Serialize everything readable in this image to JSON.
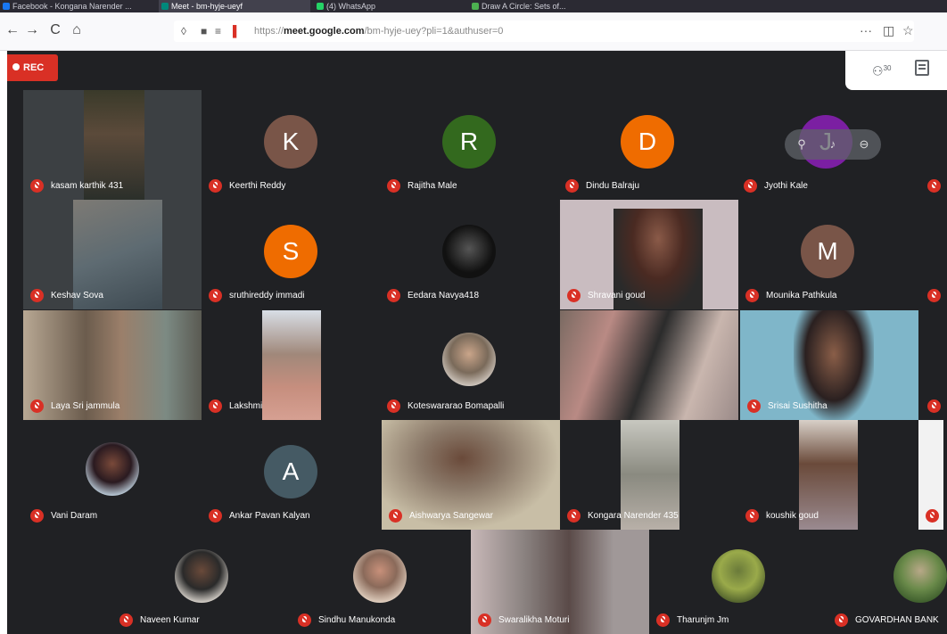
{
  "browser": {
    "tabs": [
      {
        "label": "Facebook - Kongana Narender ..."
      },
      {
        "label": "Meet - bm-hyje-ueyf"
      },
      {
        "label": "(4) WhatsApp"
      },
      {
        "label": "Draw A Circle: Sets of..."
      }
    ],
    "url_domain": "meet.google.com",
    "url_prefix": "https://",
    "url_path": "/bm-hyje-uey?pli=1&authuser=0",
    "more_label": "···",
    "nav": {
      "back": "←",
      "forward": "→",
      "reload": "C",
      "home": "⌂"
    }
  },
  "meet": {
    "rec_label": "REC",
    "people_count": "30",
    "participants": [
      {
        "name": "kasam karthik 431",
        "kind": "video"
      },
      {
        "name": "Keerthi Reddy",
        "kind": "letter",
        "letter": "K",
        "color": "#795548"
      },
      {
        "name": "Rajitha Male",
        "kind": "letter",
        "letter": "R",
        "color": "#33691e"
      },
      {
        "name": "Dindu Balraju",
        "kind": "letter",
        "letter": "D",
        "color": "#ef6c00"
      },
      {
        "name": "Jyothi Kale",
        "kind": "letter",
        "letter": "J",
        "color": "#7b1fa2"
      },
      {
        "name": "Keshav Sova",
        "kind": "video"
      },
      {
        "name": "sruthireddy immadi",
        "kind": "letter",
        "letter": "S",
        "color": "#ef6c00"
      },
      {
        "name": "Eedara Navya418",
        "kind": "photo"
      },
      {
        "name": "Shravani goud",
        "kind": "video"
      },
      {
        "name": "Mounika Pathkula",
        "kind": "letter",
        "letter": "M",
        "color": "#795548"
      },
      {
        "name": "Laya Sri jammula",
        "kind": "video"
      },
      {
        "name": "Lakshmi",
        "kind": "video"
      },
      {
        "name": "Koteswararao Bomapalli",
        "kind": "photo"
      },
      {
        "name": "",
        "kind": "video"
      },
      {
        "name": "Srisai Sushitha",
        "kind": "video"
      },
      {
        "name": "Vani Daram",
        "kind": "photo"
      },
      {
        "name": "Ankar Pavan Kalyan",
        "kind": "letter",
        "letter": "A",
        "color": "#455a64"
      },
      {
        "name": "Aishwarya Sangewar",
        "kind": "video"
      },
      {
        "name": "Kongara Narender 435",
        "kind": "video"
      },
      {
        "name": "koushik goud",
        "kind": "video"
      },
      {
        "name": "Naveen Kumar",
        "kind": "photo"
      },
      {
        "name": "Sindhu Manukonda",
        "kind": "photo"
      },
      {
        "name": "Swaralikha Moturi",
        "kind": "video"
      },
      {
        "name": "Tharunjm Jm",
        "kind": "photo"
      },
      {
        "name": "GOVARDHAN BANK",
        "kind": "photo"
      }
    ]
  },
  "colors": {
    "meet_bg": "#202124",
    "tile_bg": "#3c4043",
    "mic_muted": "#d93025",
    "rec": "#d93025"
  }
}
